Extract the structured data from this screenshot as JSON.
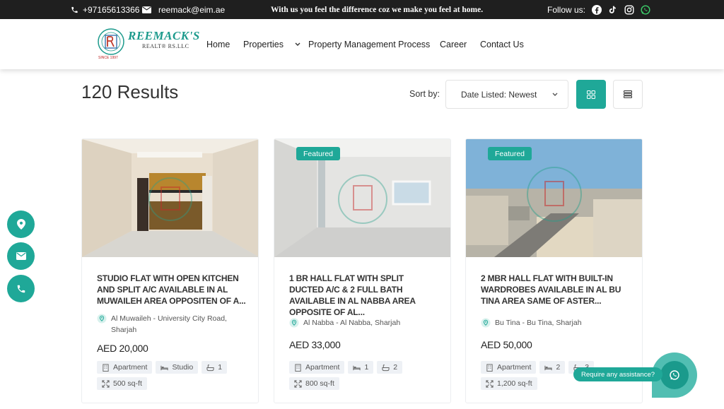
{
  "topbar": {
    "phone": "+97165613366",
    "email": "reemack@eim.ae",
    "tagline": "With us you feel the difference coz we make you feel at home.",
    "follow_label": "Follow us:",
    "social_icons": [
      "facebook-icon",
      "tiktok-icon",
      "instagram-icon",
      "whatsapp-icon"
    ]
  },
  "logo": {
    "name": "REEMACK'S",
    "sub": "REALT® RS.LLC",
    "since": "SINCE 1997"
  },
  "nav": {
    "home": "Home",
    "properties": "Properties",
    "process": "Property Management Process",
    "career": "Career",
    "contact": "Contact Us"
  },
  "results": {
    "count_label": "120 Results",
    "sort_label": "Sort by:",
    "sort_value": "Date Listed: Newest"
  },
  "colors": {
    "accent": "#1fa898",
    "topbar": "#1f1f1f"
  },
  "listings": [
    {
      "featured": "",
      "title": "STUDIO FLAT WITH OPEN KITCHEN AND SPLIT A/C AVAILABLE IN AL MUWAILEH AREA OPPOSITEN OF A...",
      "location": "Al Muwaileh - University City Road, Sharjah",
      "price": "AED 20,000",
      "type": "Apartment",
      "beds": "Studio",
      "baths": "1",
      "area": "500 sq-ft"
    },
    {
      "featured": "Featured",
      "title": "1 BR HALL FLAT WITH SPLIT DUCTED A/C & 2 FULL BATH AVAILABLE IN AL NABBA AREA OPPOSITE OF AL...",
      "location": "Al Nabba - Al Nabba, Sharjah",
      "price": "AED 33,000",
      "type": "Apartment",
      "beds": "1",
      "baths": "2",
      "area": "800 sq-ft"
    },
    {
      "featured": "Featured",
      "title": "2 MBR HALL FLAT WITH BUILT-IN WARDROBES AVAILABLE IN AL BU TINA AREA SAME OF ASTER...",
      "location": "Bu Tina - Bu Tina, Sharjah",
      "price": "AED 50,000",
      "type": "Apartment",
      "beds": "2",
      "baths": "3",
      "area": "1,200 sq-ft"
    }
  ],
  "assist_label": "Require any assistance?"
}
